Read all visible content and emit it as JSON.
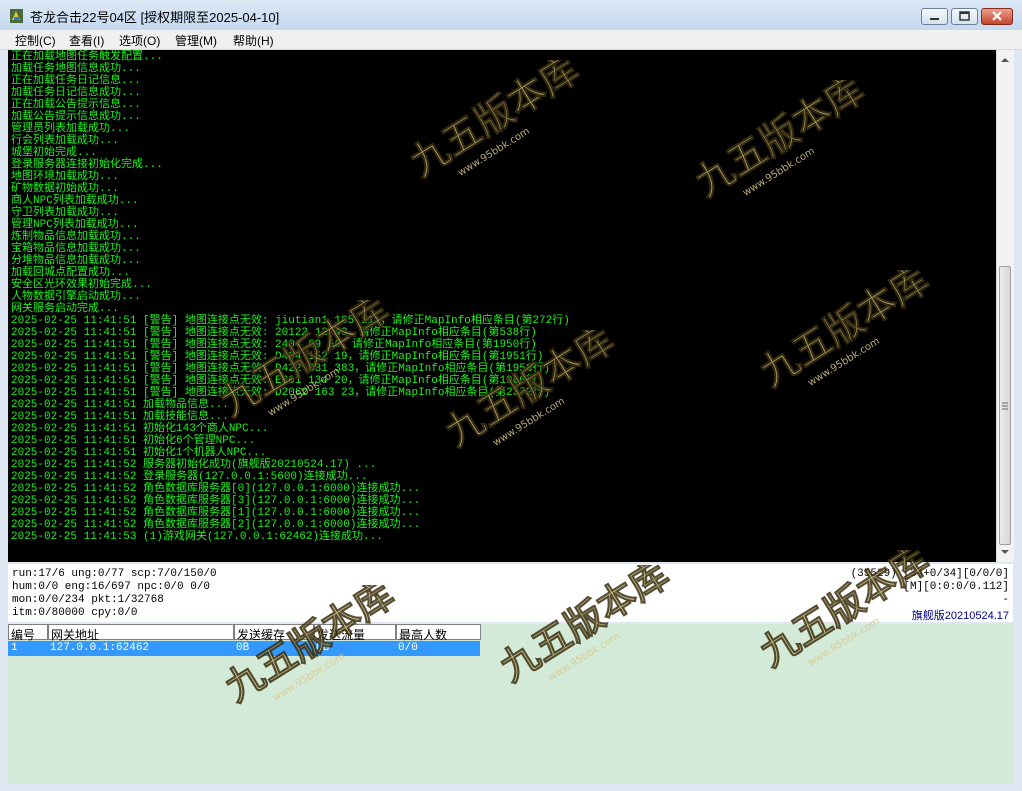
{
  "window": {
    "title": "苍龙合击22号04区 [授权期限至2025-04-10]"
  },
  "menu": [
    "控制(C)",
    "查看(I)",
    "选项(O)",
    "管理(M)",
    "帮助(H)"
  ],
  "log_lines": [
    "正在加载地图任务触发配置...",
    "加载任务地图信息成功...",
    "正在加载任务日记信息...",
    "加载任务日记信息成功...",
    "正在加载公告提示信息...",
    "加载公告提示信息成功...",
    "管理员列表加载成功...",
    "行会列表加载成功...",
    "城堡初始完成...",
    "登录服务器连接初始化完成...",
    "地图环境加载成功...",
    "矿物数据初始成功...",
    "商人NPC列表加载成功...",
    "守卫列表加载成功...",
    "管理NPC列表加载成功...",
    "炼制物品信息加载成功...",
    "宝箱物品信息加载成功...",
    "分堆物品信息加载成功...",
    "加载回城点配置成功...",
    "安全区光环效果初始完成...",
    "人物数据引擎启动成功...",
    "网关服务启动完成...",
    "2025-02-25 11:41:51 [警告] 地图连接点无效: jiutian1 185 111，请修正MapInfo相应条目(第272行)",
    "2025-02-25 11:41:51 [警告] 地图连接点无效: 20122 12 43，请修正MapInfo相应条目(第538行)",
    "2025-02-25 11:41:51 [警告] 地图连接点无效: 2404 69 56，请修正MapInfo相应条目(第1950行)",
    "2025-02-25 11:41:51 [警告] 地图连接点无效: D404 152 19，请修正MapInfo相应条目(第1951行)",
    "2025-02-25 11:41:51 [警告] 地图连接点无效: D422 331 383，请修正MapInfo相应条目(第1958行)",
    "2025-02-25 11:41:51 [警告] 地图连接点无效: E601 134 20，请修正MapInfo相应条目(第1960行)",
    "2025-02-25 11:41:51 [警告] 地图连接点无效: D2062 163 23，请修正MapInfo相应条目(第2372行)",
    "2025-02-25 11:41:51 加载物品信息...",
    "2025-02-25 11:41:51 加载技能信息...",
    "2025-02-25 11:41:51 初始化143个商人NPC...",
    "2025-02-25 11:41:51 初始化6个管理NPC...",
    "2025-02-25 11:41:51 初始化1个机器人NPC...",
    "2025-02-25 11:41:52 服务器初始化成功(旗舰版20210524.17) ...",
    "2025-02-25 11:41:52 登录服务器(127.0.0.1:5600)连接成功...",
    "2025-02-25 11:41:52 角色数据库服务器[0](127.0.0.1:6000)连接成功...",
    "2025-02-25 11:41:52 角色数据库服务器[3](127.0.0.1:6000)连接成功...",
    "2025-02-25 11:41:52 角色数据库服务器[1](127.0.0.1:6000)连接成功...",
    "2025-02-25 11:41:52 角色数据库服务器[2](127.0.0.1:6000)连接成功...",
    "2025-02-25 11:41:53 (1)游戏网关(127.0.0.1:62462)连接成功..."
  ],
  "stats": {
    "line1": "run:17/6 ung:0/77 scp:7/0/150/0",
    "line2": "hum:0/0 eng:16/697 npc:0/0 0/0",
    "line3": "mon:0/0/234 pkt:1/32768",
    "line4": "itm:0/80000 cpy:0/0",
    "right1": "(35529) [34+0/34][0/0/0]",
    "right2": "[M][0:0:0/0.112]",
    "right3": "-",
    "version": "旗舰版20210524.17"
  },
  "gateway_table": {
    "columns": [
      "编号",
      "网关地址",
      "发送缓存",
      "发送流量",
      "最高人数"
    ],
    "rows": [
      [
        "1",
        "127.0.0.1:62462",
        "0B",
        "0B",
        "0/0"
      ]
    ]
  },
  "watermark": {
    "brand": "九五版本库",
    "url": "www.95bbk.com",
    "color": "#d9c98a"
  }
}
